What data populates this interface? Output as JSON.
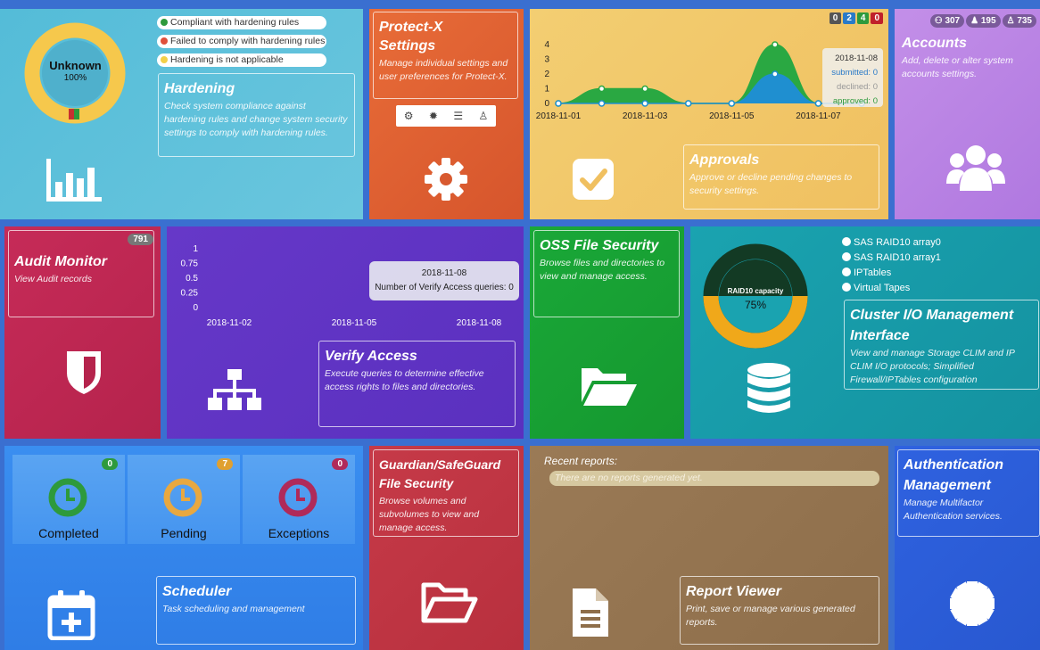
{
  "hardening": {
    "gauge_label": "Unknown",
    "gauge_percent": "100%",
    "legend": [
      "Compliant with hardening rules",
      "Failed to comply with hardening rules",
      "Hardening is not applicable"
    ],
    "legend_colors": [
      "#2e9a3c",
      "#e0503c",
      "#f2d04a"
    ],
    "title": "Hardening",
    "desc": "Check system compliance against hardening rules and change system security settings to comply with hardening rules.",
    "icon": "bar-chart-icon"
  },
  "protectx": {
    "title_line1": "Protect-X",
    "title_line2": "Settings",
    "desc": "Manage individual settings and user preferences for Protect-X.",
    "toolbar_icons": [
      "cogs-icon",
      "cog-icon",
      "list-icon",
      "user-icon"
    ],
    "icon": "gear-icon"
  },
  "approvals": {
    "badges": [
      "0",
      "2",
      "4",
      "0"
    ],
    "badge_colors": [
      "#555555",
      "#2a7ac8",
      "#2e9a3c",
      "#c0202a"
    ],
    "tooltip": {
      "date": "2018-11-08",
      "submitted": "submitted: 0",
      "declined": "declined: 0",
      "approved": "approved: 0"
    },
    "title": "Approvals",
    "desc": "Approve or decline pending changes to security settings.",
    "icon": "checkbox-icon",
    "chart_data": {
      "type": "area",
      "x": [
        "2018-11-01",
        "2018-11-02",
        "2018-11-03",
        "2018-11-04",
        "2018-11-05",
        "2018-11-06",
        "2018-11-07",
        "2018-11-08"
      ],
      "x_tick_labels": [
        "2018-11-01",
        "2018-11-03",
        "2018-11-05",
        "2018-11-07"
      ],
      "series": [
        {
          "values": [
            0,
            1,
            1,
            0,
            0,
            4,
            0,
            0
          ],
          "color": "#2aa842"
        },
        {
          "values": [
            0,
            0,
            0,
            0,
            0,
            2,
            0,
            0
          ],
          "color": "#1f8fd0"
        }
      ],
      "y_ticks": [
        "0",
        "1",
        "2",
        "3",
        "4"
      ],
      "ylim": [
        0,
        4
      ]
    }
  },
  "accounts": {
    "badges": [
      "307",
      "195",
      "735"
    ],
    "title": "Accounts",
    "desc": "Add, delete or alter system accounts settings.",
    "icon": "users-icon"
  },
  "audit": {
    "badge": "791",
    "title": "Audit Monitor",
    "desc": "View Audit records",
    "icon": "shield-icon"
  },
  "verify": {
    "tooltip_date": "2018-11-08",
    "tooltip_text": "Number of Verify Access queries: 0",
    "title": "Verify Access",
    "desc": "Execute queries to determine effective access rights to files and directories.",
    "icon": "sitemap-icon",
    "chart_data": {
      "type": "line",
      "x_tick_labels": [
        "2018-11-02",
        "2018-11-05",
        "2018-11-08"
      ],
      "y_ticks": [
        "0",
        "0.25",
        "0.5",
        "0.75",
        "1"
      ],
      "ylim": [
        0,
        1
      ],
      "series": []
    }
  },
  "oss": {
    "title": "OSS File Security",
    "desc": "Browse files and directories to view and manage access.",
    "icon": "folder-open-icon"
  },
  "cluster": {
    "gauge_label": "RAID10 capacity",
    "gauge_percent": "75%",
    "gauge_value": 0.75,
    "legend": [
      "SAS RAID10 array0",
      "SAS RAID10 array1",
      "IPTables",
      "Virtual Tapes"
    ],
    "title_line1": "Cluster I/O Management",
    "title_line2": "Interface",
    "desc": "View and manage Storage CLIM and IP CLIM I/O protocols; Simplified Firewall/IPTables configuration",
    "icon": "database-icon"
  },
  "scheduler": {
    "cells": [
      {
        "label": "Completed",
        "badge": "0",
        "color": "#2e9a3c"
      },
      {
        "label": "Pending",
        "badge": "7",
        "color": "#e0a030"
      },
      {
        "label": "Exceptions",
        "badge": "0",
        "color": "#b02a5a"
      }
    ],
    "title": "Scheduler",
    "desc": "Task scheduling and management",
    "icon": "calendar-plus-icon"
  },
  "guardian": {
    "title_line1": "Guardian/SafeGuard",
    "title_line2": "File Security",
    "desc": "Browse volumes and subvolumes to view and manage access.",
    "icon": "folder-open-outline-icon"
  },
  "reports": {
    "heading": "Recent reports:",
    "empty_text": "There are no reports generated yet.",
    "title": "Report Viewer",
    "desc": "Print, save or manage various generated reports.",
    "icon": "document-icon"
  },
  "auth": {
    "title_line1": "Authentication",
    "title_line2": "Management",
    "desc": "Manage Multifactor Authentication services.",
    "icon": "certificate-icon"
  }
}
